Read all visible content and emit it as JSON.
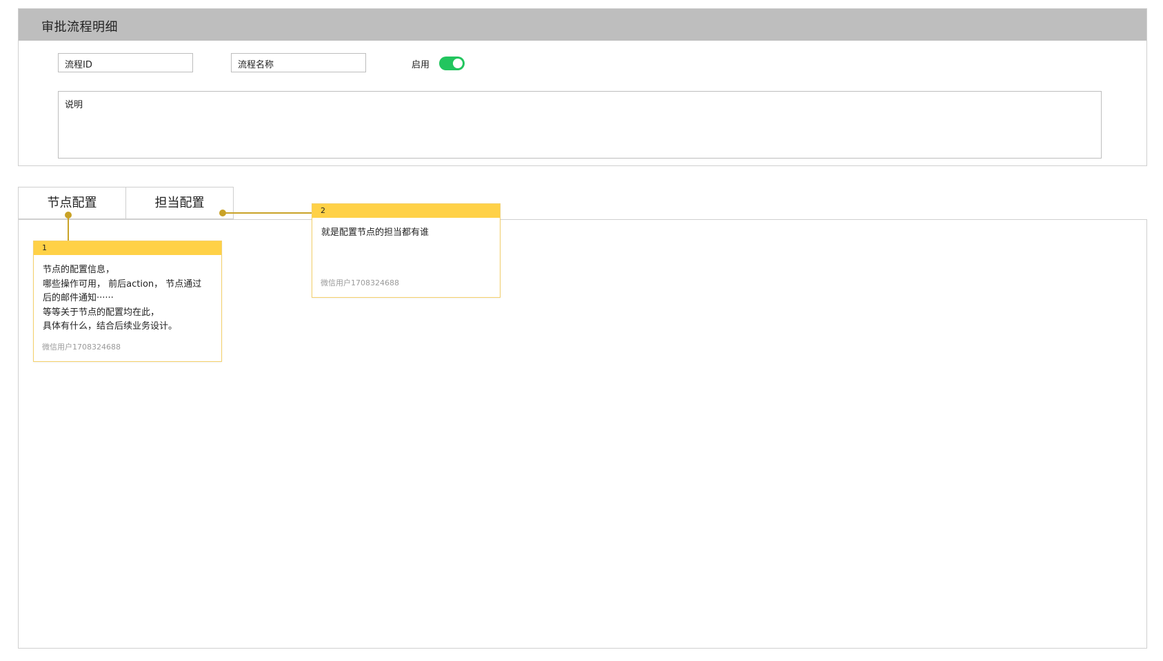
{
  "header": {
    "title": "审批流程明细"
  },
  "form": {
    "flow_id_placeholder": "流程ID",
    "flow_name_placeholder": "流程名称",
    "enable_label": "启用",
    "enabled": true,
    "description_placeholder": "说明"
  },
  "tabs": [
    {
      "label": "节点配置"
    },
    {
      "label": "担当配置"
    }
  ],
  "notes": [
    {
      "number": "1",
      "text": "节点的配置信息，\n哪些操作可用， 前后action， 节点通过\n后的邮件通知······\n等等关于节点的配置均在此，\n具体有什么，结合后续业务设计。",
      "author": "微信用户1708324688"
    },
    {
      "number": "2",
      "text": "就是配置节点的担当都有谁",
      "author": "微信用户1708324688"
    }
  ],
  "colors": {
    "header_bg": "#bebebe",
    "toggle_on": "#22c55e",
    "note_bar": "#ffd147",
    "connector": "#c9a227"
  },
  "icons": {
    "toggle": "toggle-switch-on"
  }
}
